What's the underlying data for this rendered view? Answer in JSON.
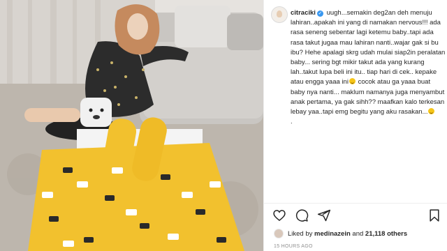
{
  "post": {
    "username": "citraciki",
    "verified_mark": "✓",
    "caption_parts": [
      "uugh...semakin deg2an deh menuju lahiran..apakah ini yang di namakan nervous!!! ada rasa seneng sebentar lagi ketemu baby..tapi ada rasa takut jugaa mau lahiran nanti..wajar gak si bu ibu? Hehe apalagi skrg udah mulai siap2in peralatan baby... sering bgt mikir takut ada yang kurang lah..takut lupa beli ini itu.. tiap hari di cek.. kepake atau engga yaaa ini",
      " cocok atau ga yaaa buat baby nya nanti... maklum namanya juga menyambut anak pertama, ya gak sihh?? maafkan kalo terkesan lebay yaa..tapi emg begitu yang aku rasakan...",
      "\n."
    ],
    "likes": {
      "prefix": "Liked by",
      "user": "medinazein",
      "conjunction": "and",
      "count": "21,118 others"
    },
    "timestamp": "15 HOURS AGO"
  },
  "icons": [
    "heart-icon",
    "comment-icon",
    "share-icon",
    "bookmark-icon",
    "face-emoji-icon",
    "grin-emoji-icon"
  ],
  "colors": {
    "verified": "#3897f0",
    "text": "#262626",
    "muted": "#8e8e8e",
    "divider": "#efefef",
    "blanket_yellow": "#f2c12e"
  }
}
